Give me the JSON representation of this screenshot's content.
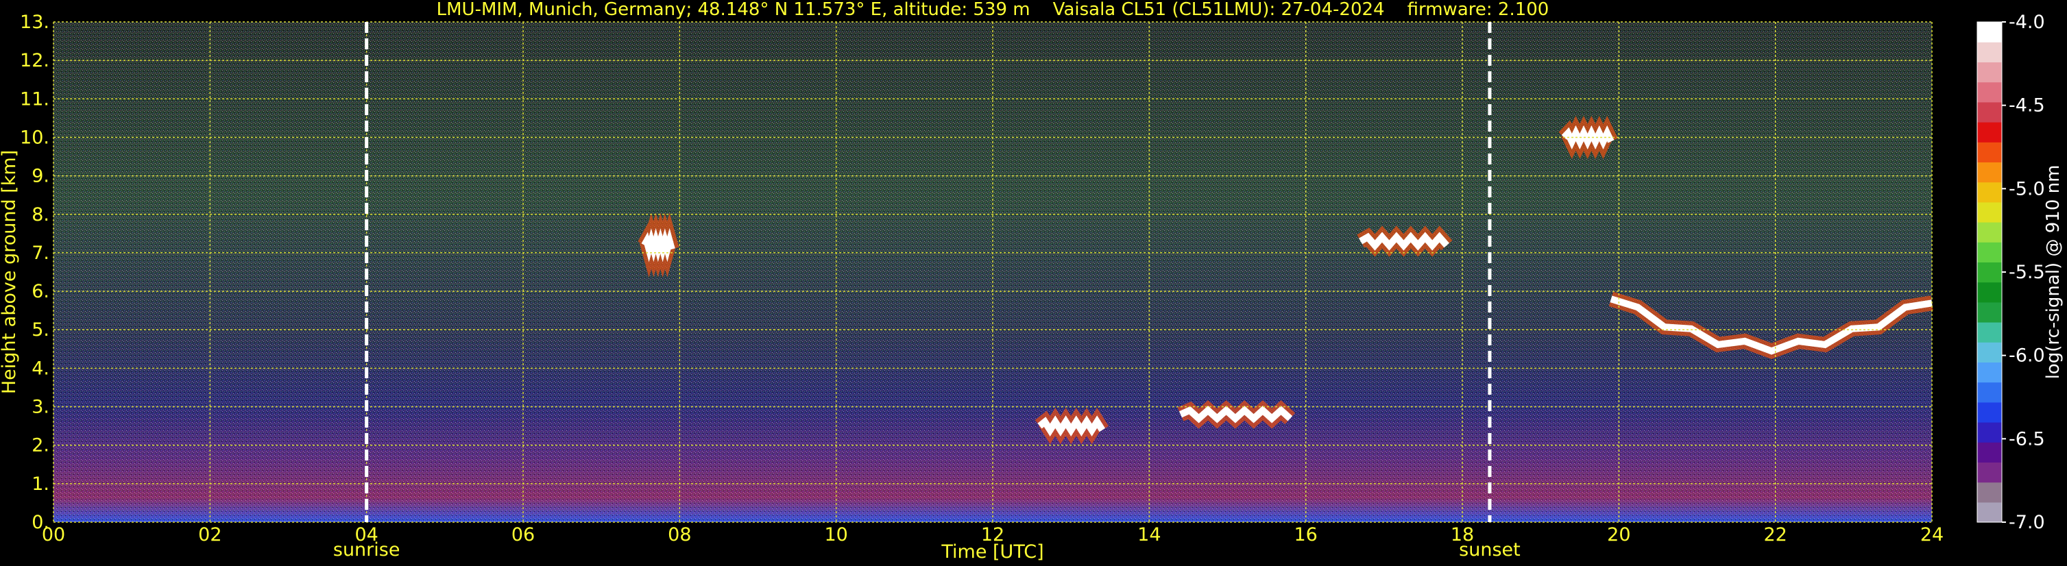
{
  "chart_data": {
    "type": "heatmap",
    "title": "LMU-MIM, Munich, Germany; 48.148° N 11.573° E, altitude: 539 m    Vaisala CL51 (CL51LMU): 27-04-2024    firmware: 2.100",
    "xlabel": "Time [UTC]",
    "ylabel": "Height above ground [km]",
    "colorbar_label": "log(rc-signal) @ 910 nm",
    "x_ticks": [
      "00",
      "02",
      "04",
      "06",
      "08",
      "10",
      "12",
      "14",
      "16",
      "18",
      "20",
      "22",
      "24"
    ],
    "y_ticks": [
      "0.",
      "1.",
      "2.",
      "3.",
      "4.",
      "5.",
      "6.",
      "7.",
      "8.",
      "9.",
      "10.",
      "11.",
      "12.",
      "13."
    ],
    "colorbar_ticks": [
      "-4.0",
      "-4.5",
      "-5.0",
      "-5.5",
      "-6.0",
      "-6.5",
      "-7.0"
    ],
    "xlim": [
      0,
      24
    ],
    "ylim": [
      0,
      13
    ],
    "clim": [
      -7.0,
      -4.0
    ],
    "grid": true,
    "colorbar_colors": [
      "#a8a0b8",
      "#907890",
      "#7a2a8a",
      "#5a1090",
      "#3020c0",
      "#2040e8",
      "#3070f0",
      "#50a0f8",
      "#60c0e0",
      "#40c0a0",
      "#20a040",
      "#109020",
      "#30b030",
      "#60d040",
      "#a0e040",
      "#e0e020",
      "#f0c010",
      "#f89010",
      "#f05010",
      "#e01010",
      "#d04050",
      "#e07080",
      "#e8a0a8",
      "#f0d0d0",
      "#ffffff"
    ],
    "vertical_markers": [
      {
        "label": "sunrise",
        "time": 4.0
      },
      {
        "label": "sunset",
        "time": 18.35
      }
    ],
    "cloud_layers": [
      {
        "start": 12.6,
        "end": 13.4,
        "height": 2.5
      },
      {
        "start": 14.4,
        "end": 15.8,
        "height": 2.8
      },
      {
        "start": 7.55,
        "end": 7.9,
        "height": 7.2
      },
      {
        "start": 16.7,
        "end": 17.8,
        "height": 7.3
      },
      {
        "start": 19.3,
        "end": 19.9,
        "height": 10.0
      },
      {
        "start": 19.9,
        "end": 24.0,
        "height": 5.8
      }
    ]
  }
}
